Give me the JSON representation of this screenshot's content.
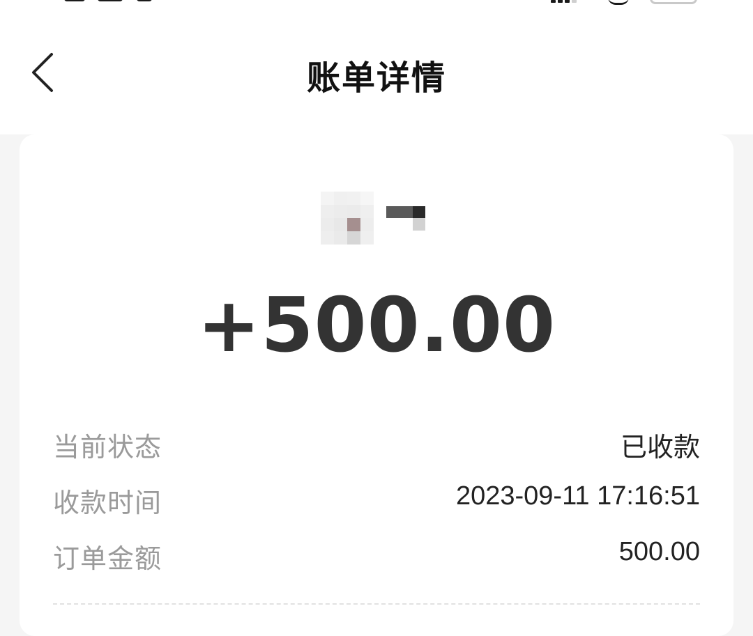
{
  "nav": {
    "title": "账单详情",
    "back_icon": "chevron-left-icon"
  },
  "status_bar": {
    "signal_icon": "signal-icon",
    "wifi_icon": "wifi-icon",
    "battery_icon": "battery-icon"
  },
  "card": {
    "avatar_icon": "merchant-avatar",
    "amount": "+500.00",
    "details": [
      {
        "label": "当前状态",
        "value": "已收款"
      },
      {
        "label": "收款时间",
        "value": "2023-09-11 17:16:51"
      },
      {
        "label": "订单金额",
        "value": "500.00"
      }
    ]
  },
  "colors": {
    "background": "#f5f5f5",
    "card": "#ffffff",
    "amount": "#333333",
    "label": "#9a9a9a",
    "value": "#222222"
  }
}
